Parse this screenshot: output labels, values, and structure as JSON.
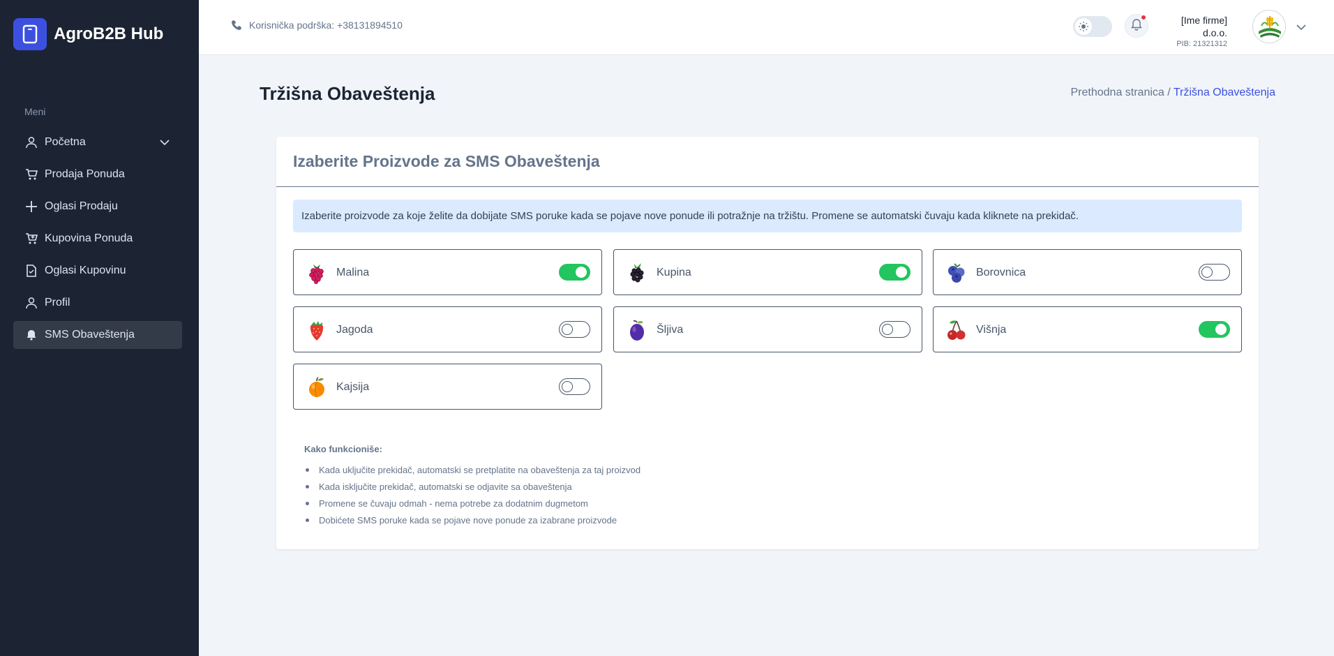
{
  "brand": {
    "name": "AgroB2B Hub"
  },
  "sidebar": {
    "menu_title": "Meni",
    "items": [
      {
        "label": "Početna",
        "icon": "user-icon",
        "has_chevron": true
      },
      {
        "label": "Prodaja Ponuda",
        "icon": "cart-icon"
      },
      {
        "label": "Oglasi Prodaju",
        "icon": "plus-icon"
      },
      {
        "label": "Kupovina Ponuda",
        "icon": "cart-plus-icon"
      },
      {
        "label": "Oglasi Kupovinu",
        "icon": "document-icon"
      },
      {
        "label": "Profil",
        "icon": "user-icon"
      },
      {
        "label": "SMS Obaveštenja",
        "icon": "bell-icon",
        "active": true
      }
    ]
  },
  "header": {
    "support_text": "Korisnička podrška: +38131894510",
    "user_name": "[Ime firme] d.o.o.",
    "user_pib": "PIB: 21321312",
    "notification_dot_color": "#dc3545"
  },
  "page": {
    "title": "Tržišna Obaveštenja",
    "breadcrumb_prev": "Prethodna stranica /",
    "breadcrumb_current": "Tržišna Obaveštenja"
  },
  "card": {
    "title": "Izaberite Proizvode za SMS Obaveštenja",
    "info": "Izaberite proizvode za koje želite da dobijate SMS poruke kada se pojave nove ponude ili potražnje na tržištu. Promene se automatski čuvaju kada kliknete na prekidač."
  },
  "products": [
    {
      "name": "Malina",
      "icon": "raspberry-icon",
      "enabled": true
    },
    {
      "name": "Kupina",
      "icon": "blackberry-icon",
      "enabled": true
    },
    {
      "name": "Borovnica",
      "icon": "blueberry-icon",
      "enabled": false
    },
    {
      "name": "Jagoda",
      "icon": "strawberry-icon",
      "enabled": false
    },
    {
      "name": "Šljiva",
      "icon": "plum-icon",
      "enabled": false
    },
    {
      "name": "Višnja",
      "icon": "cherry-icon",
      "enabled": true
    },
    {
      "name": "Kajsija",
      "icon": "apricot-icon",
      "enabled": false
    }
  ],
  "howto": {
    "title": "Kako funkcioniše:",
    "items": [
      "Kada uključite prekidač, automatski se pretplatite na obaveštenja za taj proizvod",
      "Kada isključite prekidač, automatski se odjavite sa obaveštenja",
      "Promene se čuvaju odmah - nema potrebe za dodatnim dugmetom",
      "Dobićete SMS poruke kada se pojave nove ponude za izabrane proizvode"
    ]
  },
  "colors": {
    "accent": "#3c50e0",
    "sidebar": "#1c2434",
    "toggle_on": "#22c55e"
  }
}
